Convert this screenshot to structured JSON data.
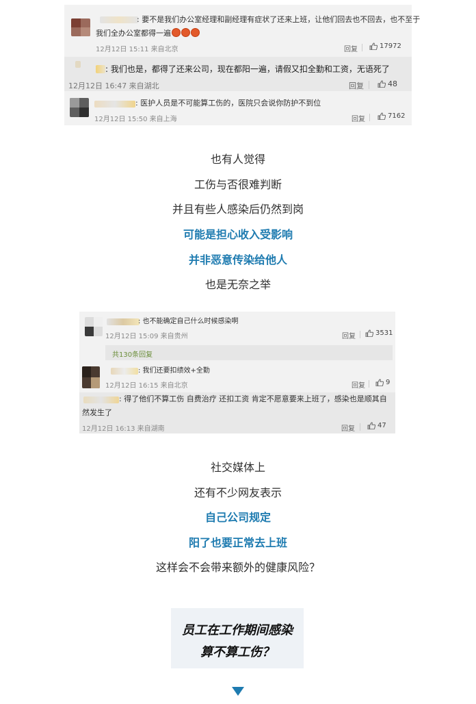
{
  "card1": {
    "comment1": {
      "text_line1": ": 要不是我们办公室经理和副经理有症状了还来上班，让他们回去也不回去，也不至于",
      "text_line2": "我们全办公室都得一遍",
      "emoji_count": 3,
      "date": "12月12日 15:11 来自北京",
      "reply_label": "回复",
      "likes": "17972"
    },
    "comment2": {
      "text": ": 我们也是，都得了还来公司，现在都阳一遍，请假又扣全勤和工资，无语死了",
      "date": "12月12日 16:47 来自湖北",
      "reply_label": "回复",
      "likes": "48"
    },
    "comment3": {
      "text": ": 医护人员是不可能算工伤的，医院只会说你防护不到位",
      "date": "12月12日 15:50 来自上海",
      "reply_label": "回复",
      "likes": "7162"
    }
  },
  "paragraphs1": [
    {
      "text": "也有人觉得",
      "emphasis": false
    },
    {
      "text": "工伤与否很难判断",
      "emphasis": false
    },
    {
      "text": "并且有些人感染后仍然到岗",
      "emphasis": false
    },
    {
      "text": "可能是担心收入受影响",
      "emphasis": true
    },
    {
      "text": "并非恶意传染给他人",
      "emphasis": true
    },
    {
      "text": "也是无奈之举",
      "emphasis": false
    }
  ],
  "card2": {
    "comment1": {
      "text": ": 也不能确定自己什么时候感染啊",
      "date": "12月12日 15:09 来自贵州",
      "reply_label": "回复",
      "likes": "3531"
    },
    "more_replies": "共130条回复",
    "comment2": {
      "text": ": 我们还要扣绩效+全勤",
      "date": "12月12日 16:15 来自北京",
      "reply_label": "回复",
      "likes": "9"
    },
    "comment3": {
      "text_line1": ": 得了他们不算工伤 自费治疗 还扣工资 肯定不愿意要来上班了，感染也是顺其自",
      "text_line2": "然发生了",
      "date": "12月12日 16:13 来自湖南",
      "reply_label": "回复",
      "likes": "47"
    }
  },
  "paragraphs2": [
    {
      "text": "社交媒体上",
      "emphasis": false
    },
    {
      "text": "还有不少网友表示",
      "emphasis": false
    },
    {
      "text": "自己公司规定",
      "emphasis": true
    },
    {
      "text": "阳了也要正常去上班",
      "emphasis": true
    },
    {
      "text": "这样会不会带来额外的健康风险？",
      "emphasis": false
    }
  ],
  "question_box": {
    "line1": "员工在工作期间感染",
    "line2": "算不算工伤？"
  },
  "colors": {
    "accent": "#1e7bb0",
    "card_bg": "#f2f2f2",
    "body_text": "#2f2f2f",
    "emoji": "#e25a2b"
  },
  "icons": [
    "thumbs-up-icon",
    "down-arrow-icon",
    "grin-emoji-icon"
  ]
}
